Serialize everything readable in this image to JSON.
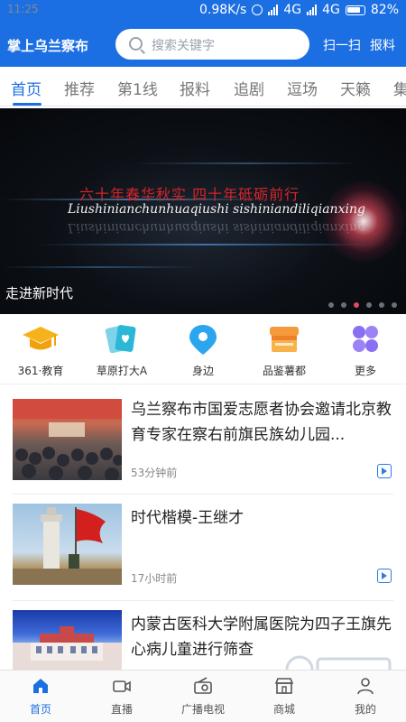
{
  "status_bar": {
    "time": "11:25",
    "net_speed": "0.98K/s",
    "network1": "4G",
    "network2": "4G",
    "battery": "82%"
  },
  "header": {
    "title": "掌上乌兰察布",
    "search_placeholder": "搜索关键字",
    "scan_label": "扫一扫",
    "report_label": "报料"
  },
  "tabs": [
    "首页",
    "推荐",
    "第1线",
    "报料",
    "追剧",
    "逗场",
    "天籁",
    "集"
  ],
  "banner": {
    "headline_cn": "六十年春华秋实  四十年砥砺前行",
    "headline_pinyin": "Liushinianchunhuaqiushi  sishiniandiliqianxing",
    "caption": "走进新时代",
    "slides": 6,
    "active_slide": 3
  },
  "quick_nav": [
    {
      "label": "361·教育",
      "icon": "graduation-cap-icon"
    },
    {
      "label": "草原打大A",
      "icon": "cards-heart-icon"
    },
    {
      "label": "身边",
      "icon": "location-pin-icon"
    },
    {
      "label": "品鉴薯都",
      "icon": "shop-awning-icon"
    },
    {
      "label": "更多",
      "icon": "grid-petals-icon"
    }
  ],
  "news": [
    {
      "title": "乌兰察布市国爱志愿者协会邀请北京教育专家在察右前旗民族幼儿园...",
      "time": "53分钟前",
      "has_video": true
    },
    {
      "title": "时代楷模-王继才",
      "time": "17小时前",
      "has_video": true
    },
    {
      "title": "内蒙古医科大学附属医院为四子王旗先心病儿童进行筛查",
      "time": "",
      "has_video": false
    }
  ],
  "bottom_nav": [
    {
      "label": "首页",
      "icon": "home-icon",
      "active": true
    },
    {
      "label": "直播",
      "icon": "video-camera-icon",
      "active": false
    },
    {
      "label": "广播电视",
      "icon": "radio-icon",
      "active": false
    },
    {
      "label": "商城",
      "icon": "store-icon",
      "active": false
    },
    {
      "label": "我的",
      "icon": "user-icon",
      "active": false
    }
  ],
  "colors": {
    "brand": "#1c6fe3",
    "video_icon": "#2b7be6",
    "banner_headline": "#d6242a"
  }
}
